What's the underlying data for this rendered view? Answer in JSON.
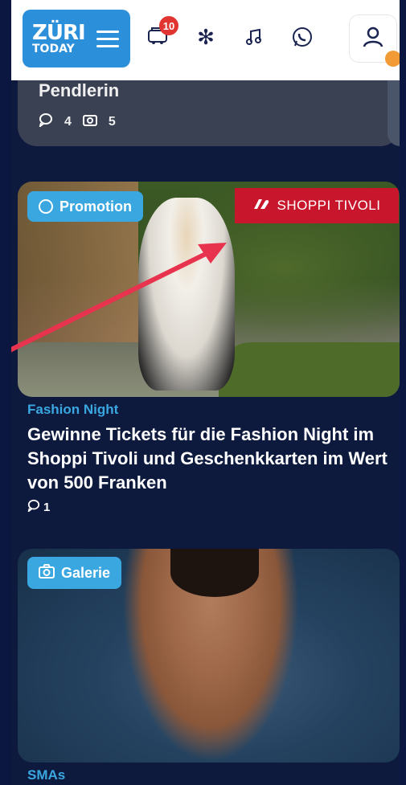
{
  "header": {
    "logo_top": "ZÜRI",
    "logo_bottom": "TODAY",
    "badge_count": "10",
    "icons": [
      "notifications-icon",
      "snowflake-icon",
      "music-icon",
      "whatsapp-icon",
      "user-icon"
    ]
  },
  "prev_article": {
    "title": "Pendlerin",
    "comment_count": "4",
    "photo_count": "5"
  },
  "promo_article": {
    "badge": "Promotion",
    "sponsor": "SHOPPI TIVOLI",
    "kicker": "Fashion Night",
    "headline": "Gewinne Tickets für die Fashion Night im Shoppi Tivoli und Geschenkkarten im Wert von 500 Franken",
    "comment_count": "1"
  },
  "gallery_article": {
    "badge": "Galerie",
    "kicker": "SMAs"
  },
  "colors": {
    "accent": "#3aa7e0",
    "brand": "#2b8fd9",
    "sponsor_red": "#c8172c",
    "badge_red": "#e03530",
    "background": "#0d1a3e"
  }
}
